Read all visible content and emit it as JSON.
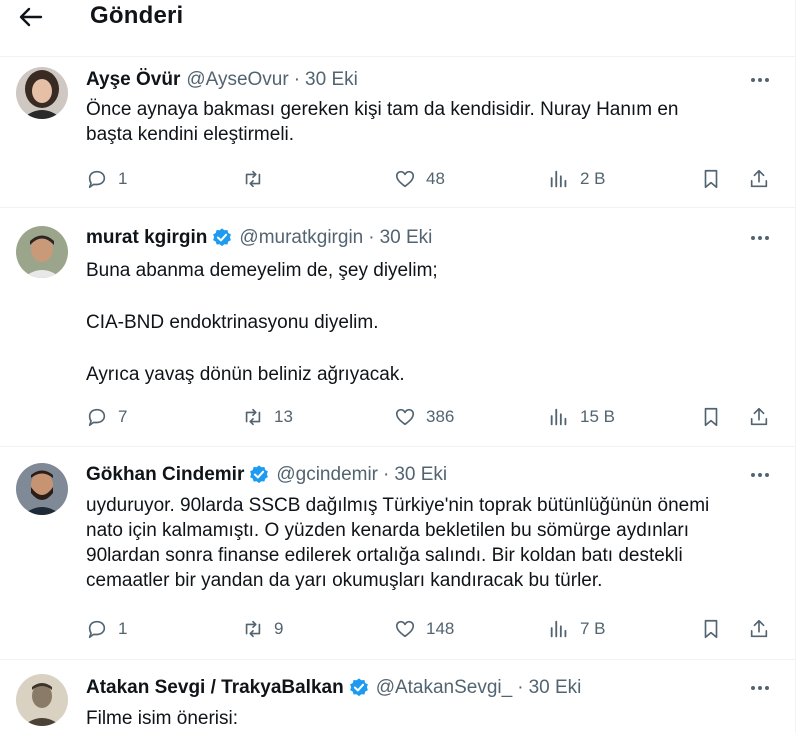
{
  "header": {
    "title": "Gönderi",
    "back_icon": "arrow-left-icon"
  },
  "posts": [
    {
      "name": "Ayşe Övür",
      "verified": false,
      "handle": "@AyseOvur",
      "dot": "·",
      "time": "30 Eki",
      "paragraphs": [
        "Önce aynaya bakması gereken kişi tam da kendisidir. Nuray Hanım en\nbaşta kendini eleştirmeli."
      ],
      "replies": "1",
      "reposts": "",
      "likes": "48",
      "views": "2 B"
    },
    {
      "name": "murat kgirgin",
      "verified": true,
      "handle": "@muratkgirgin",
      "dot": "·",
      "time": "30 Eki",
      "paragraphs": [
        "Buna abanma demeyelim de, şey diyelim;",
        "CIA-BND endoktrinasyonu diyelim.",
        "Ayrıca yavaş dönün beliniz ağrıyacak."
      ],
      "replies": "7",
      "reposts": "13",
      "likes": "386",
      "views": "15 B"
    },
    {
      "name": "Gökhan Cindemir",
      "verified": true,
      "handle": "@gcindemir",
      "dot": "·",
      "time": "30 Eki",
      "paragraphs": [
        "uyduruyor. 90larda SSCB dağılmış Türkiye'nin toprak bütünlüğünün önemi\nnato için kalmamıştı. O yüzden kenarda bekletilen bu sömürge aydınları\n90lardan sonra finanse edilerek ortalığa salındı. Bir koldan batı destekli\ncemaatler bir yandan da yarı okumuşları kandıracak bu türler."
      ],
      "replies": "1",
      "reposts": "9",
      "likes": "148",
      "views": "7 B"
    },
    {
      "name": "Atakan Sevgi / TrakyaBalkan",
      "verified": true,
      "handle": "@AtakanSevgi_",
      "dot": "·",
      "time": "30 Eki",
      "paragraphs": [
        "Filme isim önerisi:"
      ]
    }
  ],
  "colors": {
    "text": "#0f1419",
    "muted": "#536471",
    "verified": "#1d9bf0",
    "divider": "#eff3f4"
  },
  "icons": [
    "reply-icon",
    "repost-icon",
    "like-icon",
    "views-icon",
    "bookmark-icon",
    "share-icon",
    "more-icon",
    "verified-badge-icon"
  ]
}
